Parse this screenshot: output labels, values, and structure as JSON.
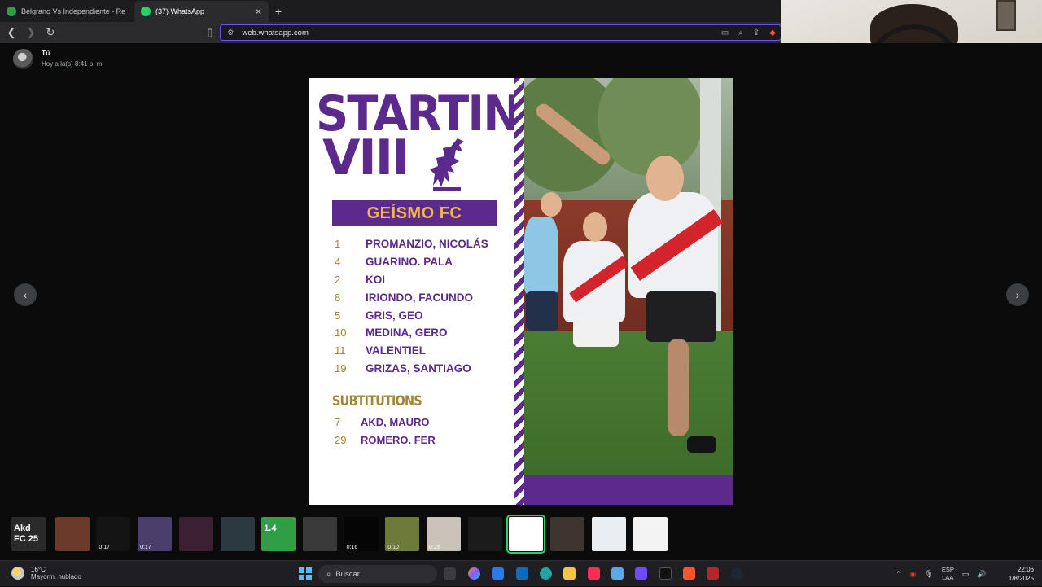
{
  "browser": {
    "tabs": [
      {
        "label": "Belgrano Vs Independiente - Resultad",
        "favicon_color": "#2ea043"
      },
      {
        "label": "(37) WhatsApp",
        "favicon_color": "#25d366",
        "active": true
      }
    ],
    "new_tab_label": "+",
    "url": "web.whatsapp.com"
  },
  "viewer": {
    "sender_name": "Tú",
    "sent_time": "Hoy a la(s) 8:41 p. m.",
    "prev_label": "‹",
    "next_label": "›"
  },
  "poster": {
    "title_line1": "STARTING",
    "title_line2": "VIII",
    "team": "GEÍSMO FC",
    "lineup": [
      {
        "number": "1",
        "name": "PROMANZIO, NICOLÁS"
      },
      {
        "number": "4",
        "name": "GUARINO. PALA"
      },
      {
        "number": "2",
        "name": "KOI"
      },
      {
        "number": "8",
        "name": "IRIONDO, FACUNDO"
      },
      {
        "number": "5",
        "name": "GRIS, GEO"
      },
      {
        "number": "10",
        "name": "MEDINA, GERO"
      },
      {
        "number": "11",
        "name": "VALENTIEL"
      },
      {
        "number": "19",
        "name": "GRIZAS, SANTIAGO"
      }
    ],
    "subs_title": "SUBTITUTIONS",
    "subs": [
      {
        "number": "7",
        "name": "AKD, MAURO"
      },
      {
        "number": "29",
        "name": "ROMERO. FER"
      }
    ],
    "colors": {
      "purple": "#5b2a8c",
      "gold": "#a0853a",
      "team_text": "#f1b64a"
    }
  },
  "thumbnails": [
    {
      "text": "Akd\nFC 25",
      "duration": "",
      "color": "#2a2a2a"
    },
    {
      "text": "",
      "duration": "",
      "color": "#6b3a2a"
    },
    {
      "text": "",
      "duration": "0:17",
      "color": "#141414"
    },
    {
      "text": "",
      "duration": "0:17",
      "color": "#4a3f6a"
    },
    {
      "text": "",
      "duration": "",
      "color": "#3a2030"
    },
    {
      "text": "",
      "duration": "",
      "color": "#2b3a40"
    },
    {
      "text": "1.4",
      "duration": "",
      "color": "#2f9e44"
    },
    {
      "text": "",
      "duration": "",
      "color": "#3a3a3a"
    },
    {
      "text": "",
      "duration": "0:16",
      "color": "#050505"
    },
    {
      "text": "",
      "duration": "0:10",
      "color": "#6e7a3a"
    },
    {
      "text": "",
      "duration": "0:25",
      "color": "#c9c2b8"
    },
    {
      "text": "",
      "duration": "",
      "color": "#1b1b1b"
    },
    {
      "text": "",
      "duration": "",
      "color": "#ffffff",
      "selected": true
    },
    {
      "text": "",
      "duration": "",
      "color": "#3d3530"
    },
    {
      "text": "",
      "duration": "",
      "color": "#e9eef3"
    },
    {
      "text": "",
      "duration": "",
      "color": "#f3f3f3"
    }
  ],
  "taskbar": {
    "temperature": "16°C",
    "condition": "Mayorm. nublado",
    "search_placeholder": "Buscar",
    "lang_line1": "ESP",
    "lang_line2": "LAA",
    "time": "22:06",
    "date": "1/8/2025"
  }
}
